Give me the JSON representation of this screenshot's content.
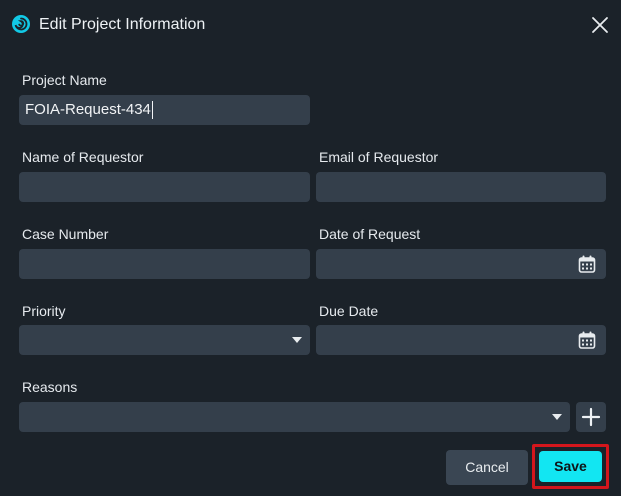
{
  "dialog": {
    "title": "Edit Project Information",
    "app_icon": "swirl-logo-icon",
    "close_icon": "close-icon"
  },
  "fields": {
    "project_name": {
      "label": "Project Name",
      "value": "FOIA-Request-434"
    },
    "requestor_name": {
      "label": "Name of Requestor",
      "value": ""
    },
    "requestor_email": {
      "label": "Email of Requestor",
      "value": ""
    },
    "case_number": {
      "label": "Case Number",
      "value": ""
    },
    "date_of_request": {
      "label": "Date of Request",
      "value": "",
      "icon": "calendar-icon"
    },
    "priority": {
      "label": "Priority",
      "value": ""
    },
    "due_date": {
      "label": "Due Date",
      "value": "",
      "icon": "calendar-icon"
    },
    "reasons": {
      "label": "Reasons",
      "value": "",
      "add_icon": "plus-icon"
    }
  },
  "buttons": {
    "cancel": "Cancel",
    "save": "Save"
  },
  "colors": {
    "background": "#1b2229",
    "field": "#343f4b",
    "accent": "#12e6f2",
    "highlight_border": "#d4161c"
  }
}
